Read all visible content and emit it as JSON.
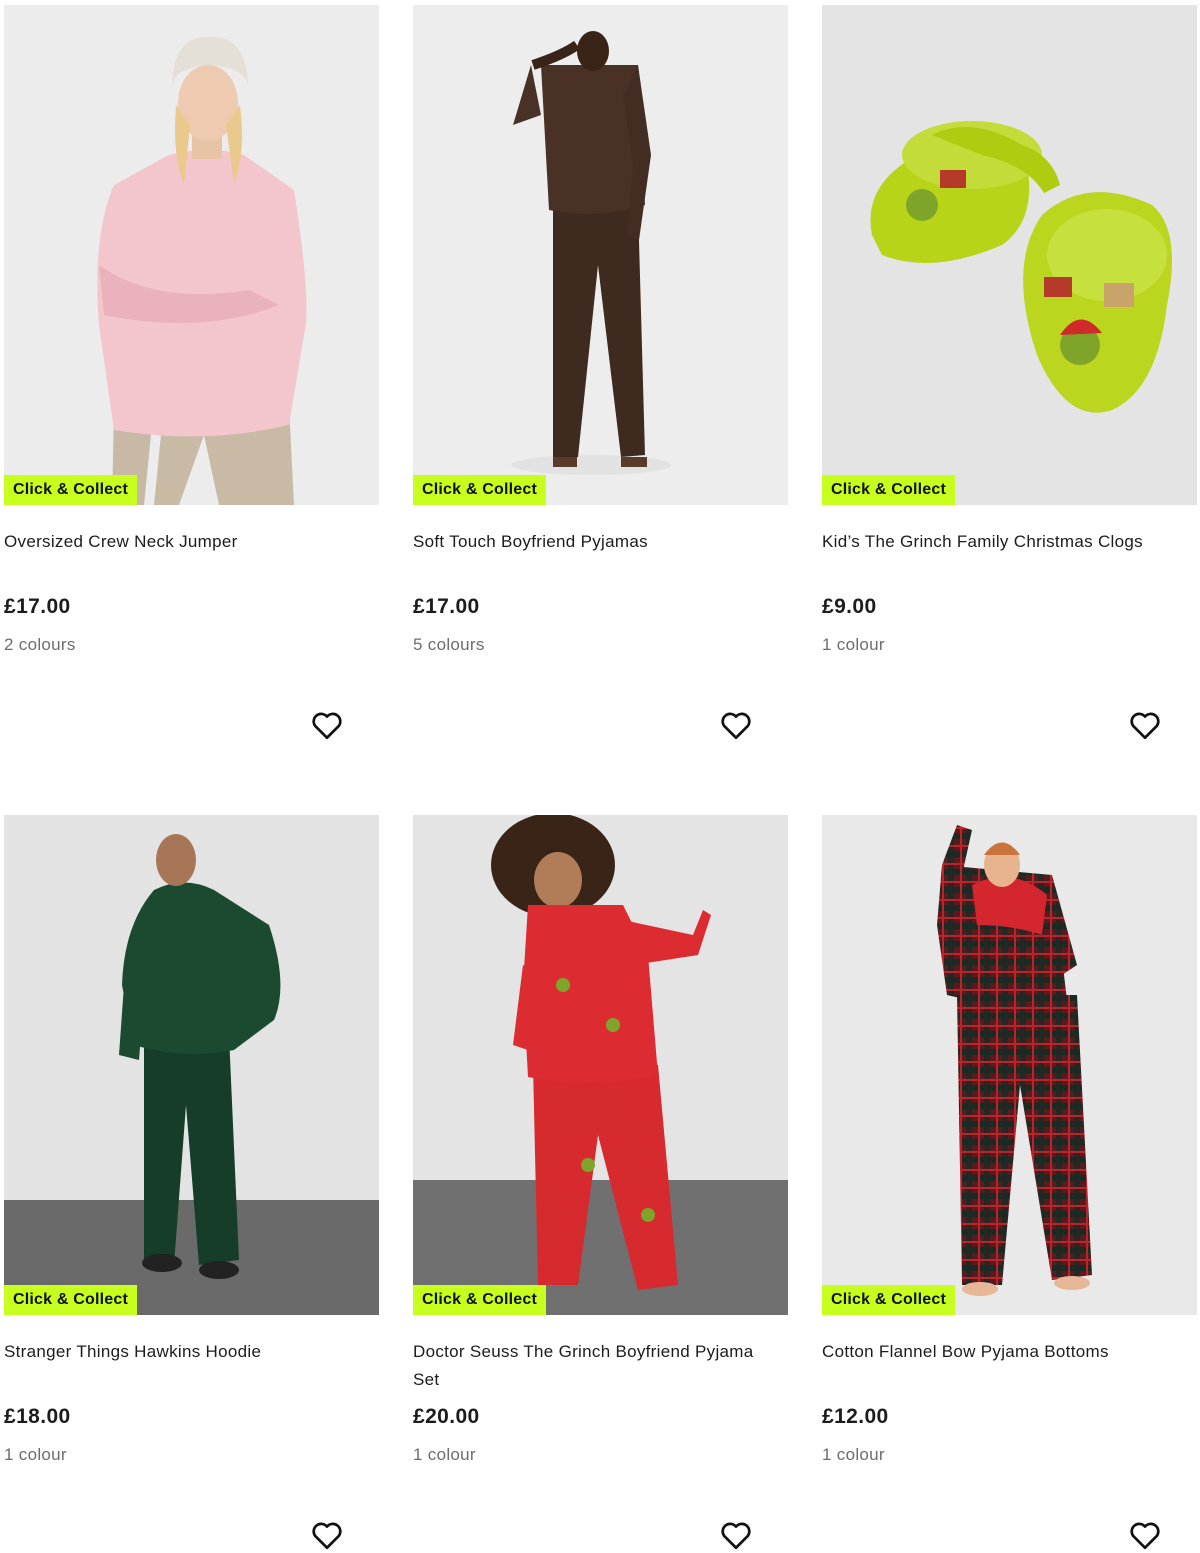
{
  "badge_color": "#c7ff1f",
  "products": [
    {
      "title": "Oversized Crew Neck Jumper",
      "price": "£17.00",
      "colours": "2 colours",
      "badge": "Click & Collect",
      "wishlist_icon": "heart-outline-icon"
    },
    {
      "title": "Soft Touch Boyfriend Pyjamas",
      "price": "£17.00",
      "colours": "5 colours",
      "badge": "Click & Collect",
      "wishlist_icon": "heart-outline-icon"
    },
    {
      "title": "Kid’s The Grinch Family Christmas Clogs",
      "price": "£9.00",
      "colours": "1 colour",
      "badge": "Click & Collect",
      "wishlist_icon": "heart-outline-icon"
    },
    {
      "title": "Stranger Things Hawkins Hoodie",
      "price": "£18.00",
      "colours": "1 colour",
      "badge": "Click & Collect",
      "wishlist_icon": "heart-outline-icon"
    },
    {
      "title": "Doctor Seuss The Grinch Boyfriend Pyjama Set",
      "price": "£20.00",
      "colours": "1 colour",
      "badge": "Click & Collect",
      "wishlist_icon": "heart-outline-icon"
    },
    {
      "title": "Cotton Flannel Bow Pyjama Bottoms",
      "price": "£12.00",
      "colours": "1 colour",
      "badge": "Click & Collect",
      "wishlist_icon": "heart-outline-icon"
    }
  ]
}
